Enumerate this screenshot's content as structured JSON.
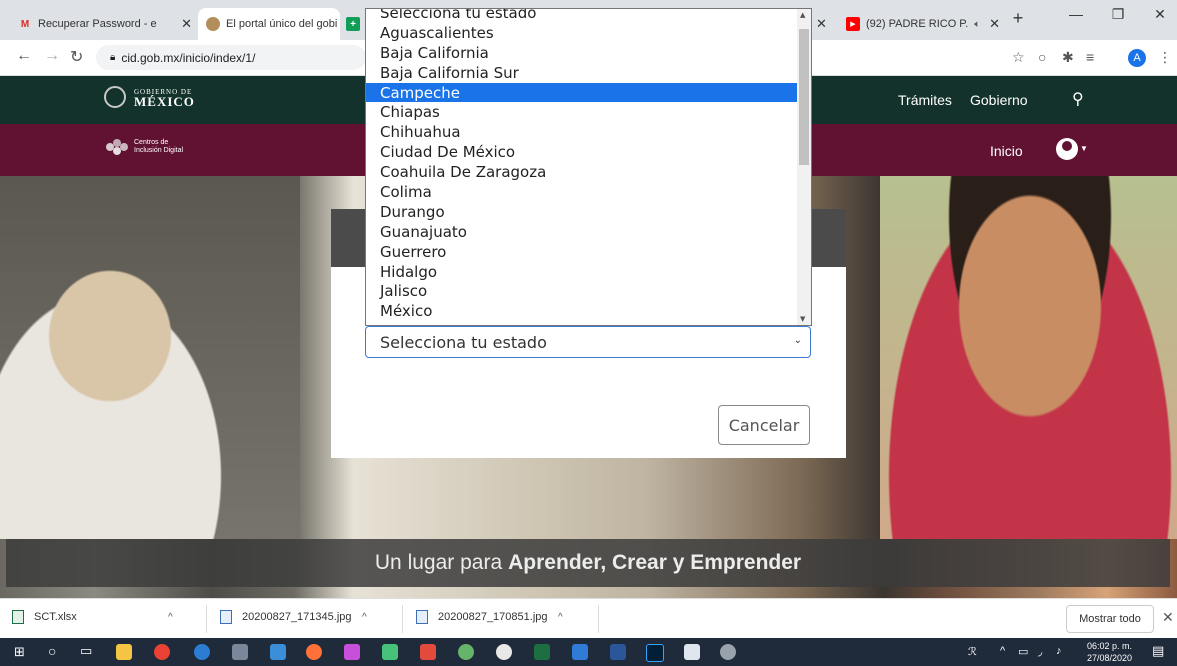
{
  "browser": {
    "tabs": [
      {
        "title": "Recuperar Password - e",
        "favicon": "gmail-icon"
      },
      {
        "title": "El portal único del gobi",
        "favicon": "gob-icon"
      },
      {
        "title": "(92) PADRE RICO P.",
        "favicon": "youtube-icon"
      }
    ],
    "url": "cid.gob.mx/inicio/index/1/",
    "profile_initial": "A"
  },
  "site": {
    "gob_small": "GOBIERNO DE",
    "gob_big": "MÉXICO",
    "nav_tramites": "Trámites",
    "nav_gobierno": "Gobierno",
    "cid_logo_text": "Centros de Inclusión Digital",
    "nav_inicio": "Inicio",
    "slogan_prefix": "Un lugar para",
    "slogan_bold": "Aprender, Crear y Emprender"
  },
  "modal": {
    "select_value": "Selecciona tu estado",
    "cancel_label": "Cancelar"
  },
  "dropdown": {
    "options": [
      "Selecciona tu estado",
      "Aguascalientes",
      "Baja California",
      "Baja California Sur",
      "Campeche",
      "Chiapas",
      "Chihuahua",
      "Ciudad De México",
      "Coahuila De Zaragoza",
      "Colima",
      "Durango",
      "Guanajuato",
      "Guerrero",
      "Hidalgo",
      "Jalisco",
      "México"
    ],
    "highlighted": "Campeche"
  },
  "downloads": {
    "items": [
      "SCT.xlsx",
      "20200827_171345.jpg",
      "20200827_170851.jpg"
    ],
    "show_all": "Mostrar todo"
  },
  "taskbar": {
    "time": "06:02 p. m.",
    "date": "27/08/2020"
  },
  "colors": {
    "gob_green": "#13322b",
    "gob_wine": "#611232",
    "select_highlight": "#1a73e8"
  }
}
